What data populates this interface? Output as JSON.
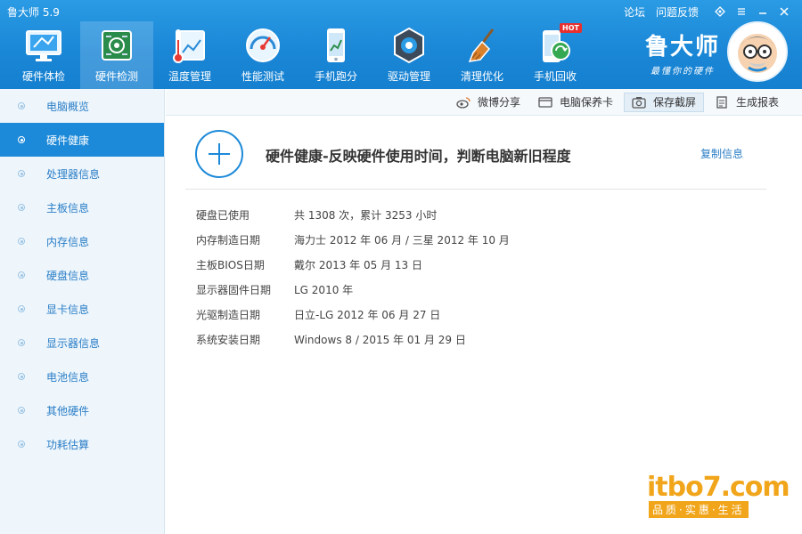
{
  "window": {
    "title": "鲁大师 5.9",
    "links": [
      "论坛",
      "问题反馈"
    ]
  },
  "toolbar": [
    {
      "label": "硬件体检",
      "icon": "monitor-icon"
    },
    {
      "label": "硬件检测",
      "icon": "circuit-board-icon",
      "active": true
    },
    {
      "label": "温度管理",
      "icon": "thermometer-icon"
    },
    {
      "label": "性能测试",
      "icon": "speedometer-icon"
    },
    {
      "label": "手机跑分",
      "icon": "phone-chart-icon"
    },
    {
      "label": "驱动管理",
      "icon": "gear-chip-icon"
    },
    {
      "label": "清理优化",
      "icon": "broom-icon"
    },
    {
      "label": "手机回收",
      "icon": "phone-recycle-icon",
      "badge": "HOT"
    }
  ],
  "brand": {
    "name": "鲁大师",
    "slogan": "最懂你的硬件"
  },
  "sidebar": [
    {
      "label": "电脑概览"
    },
    {
      "label": "硬件健康",
      "active": true
    },
    {
      "label": "处理器信息"
    },
    {
      "label": "主板信息"
    },
    {
      "label": "内存信息"
    },
    {
      "label": "硬盘信息"
    },
    {
      "label": "显卡信息"
    },
    {
      "label": "显示器信息"
    },
    {
      "label": "电池信息"
    },
    {
      "label": "其他硬件"
    },
    {
      "label": "功耗估算"
    }
  ],
  "actions": {
    "weibo": "微博分享",
    "card": "电脑保养卡",
    "screenshot": "保存截屏",
    "report": "生成报表"
  },
  "main": {
    "title": "硬件健康-反映硬件使用时间，判断电脑新旧程度",
    "copy": "复制信息",
    "rows": [
      {
        "key": "硬盘已使用",
        "value": "共 1308 次，累计 3253 小时"
      },
      {
        "key": "内存制造日期",
        "value": "海力士 2012 年 06 月 / 三星 2012 年 10 月"
      },
      {
        "key": "主板BIOS日期",
        "value": "戴尔 2013 年 05 月 13 日"
      },
      {
        "key": "显示器固件日期",
        "value": "LG 2010 年"
      },
      {
        "key": "光驱制造日期",
        "value": "日立-LG 2012 年 06 月 27 日"
      },
      {
        "key": "系统安装日期",
        "value": "Windows 8 / 2015 年 01 月 29 日"
      }
    ]
  },
  "watermark": {
    "logo": "itbo7.com",
    "tagline": "品质·实惠·生活"
  },
  "colors": {
    "topbar": "#1a86d6",
    "accent": "#1d8ad9",
    "sidebar_bg": "#eef6fc",
    "link": "#2a7dc6",
    "watermark": "#f1a51a"
  }
}
